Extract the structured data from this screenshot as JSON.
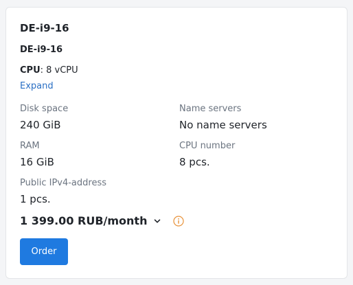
{
  "card": {
    "title": "DE-i9-16",
    "subtitle": "DE-i9-16",
    "cpu_label": "CPU",
    "cpu_value": ": 8 vCPU",
    "expand_label": "Expand"
  },
  "specs": {
    "disk": {
      "label": "Disk space",
      "value": "240 GiB"
    },
    "name_servers": {
      "label": "Name servers",
      "value": "No name servers"
    },
    "ram": {
      "label": "RAM",
      "value": "16 GiB"
    },
    "cpu_number": {
      "label": "CPU number",
      "value": "8 pcs."
    },
    "ipv4": {
      "label": "Public IPv4-address",
      "value": "1 pcs."
    }
  },
  "price": {
    "text": "1 399.00 RUB/month",
    "toggle_icon": "chevron-down-icon",
    "info_icon": "info-icon"
  },
  "order_label": "Order",
  "colors": {
    "accent": "#1f7ae0",
    "link": "#2a6fc4",
    "warning": "#e8923a"
  }
}
